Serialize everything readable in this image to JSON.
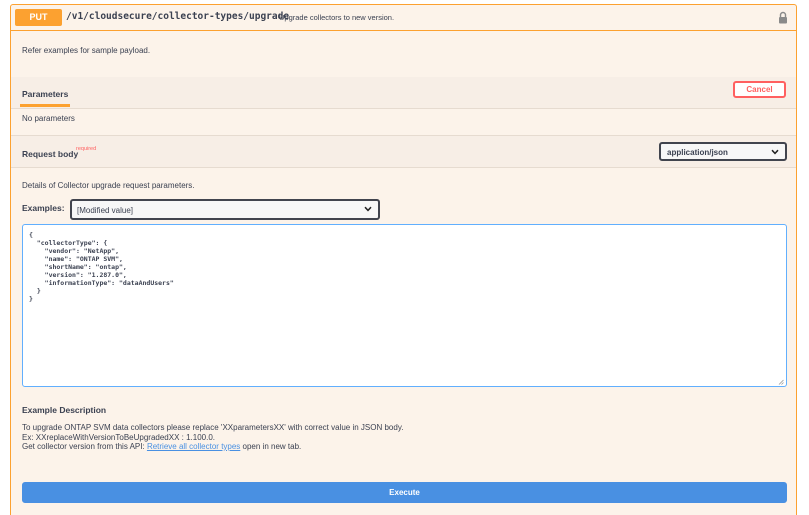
{
  "operation": {
    "method": "PUT",
    "path": "/v1/cloudsecure/collector-types/upgrade",
    "summary": "Upgrade collectors to new version.",
    "note": "Refer examples for sample payload.",
    "colors": {
      "method": "#fca130",
      "background": "#fcf3ea",
      "accent_blue": "#4990e2",
      "cancel_red": "#ff6060"
    }
  },
  "parameters": {
    "tab_label": "Parameters",
    "cancel_label": "Cancel",
    "empty_text": "No parameters"
  },
  "request_body": {
    "label": "Request body",
    "required_label": "required",
    "content_type": "application/json",
    "details": "Details of Collector upgrade request parameters.",
    "examples_label": "Examples:",
    "example_selected": "[Modified value]",
    "body": "{\n  \"collectorType\": {\n    \"vendor\": \"NetApp\",\n    \"name\": \"ONTAP SVM\",\n    \"shortName\": \"ontap\",\n    \"version\": \"1.287.0\",\n    \"informationType\": \"dataAndUsers\"\n  }\n}"
  },
  "example_description": {
    "title": "Example Description",
    "line1": "To upgrade ONTAP SVM data collectors please replace 'XXparametersXX' with correct value in JSON body.",
    "line2": "Ex: XXreplaceWithVersionToBeUpgradedXX : 1.100.0.",
    "line3_prefix": "Get collector version from this API: ",
    "line3_link": "Retrieve all collector types",
    "line3_suffix": " open in new tab."
  },
  "execute_label": "Execute",
  "icons": {
    "lock": "lock-icon",
    "chevron": "chevron-down-icon"
  }
}
